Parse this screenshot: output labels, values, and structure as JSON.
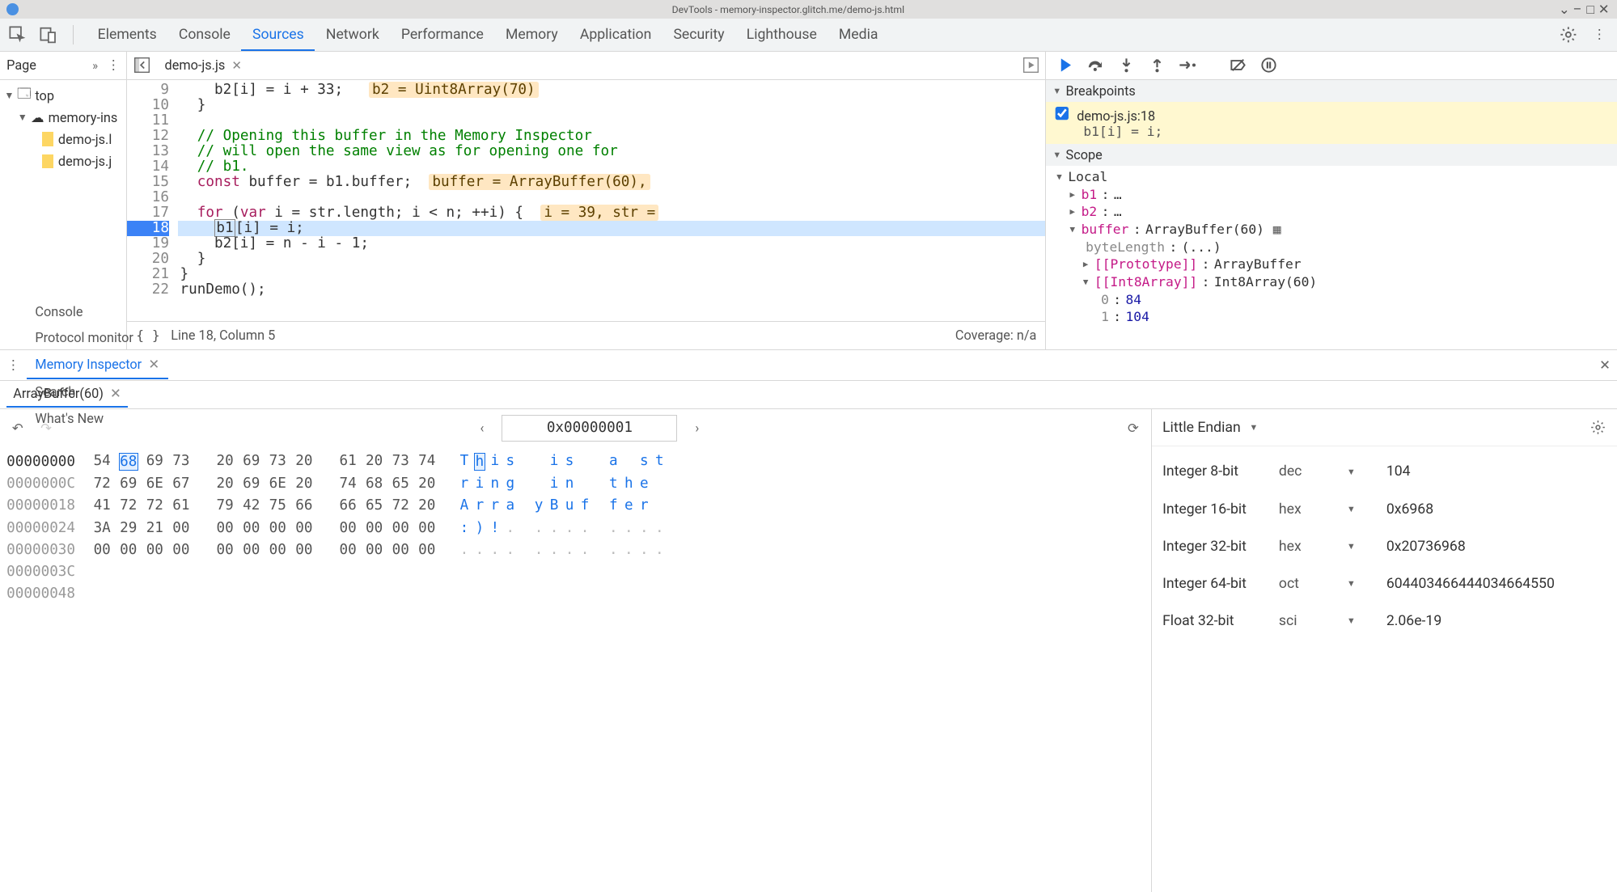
{
  "window_title": "DevTools - memory-inspector.glitch.me/demo-js.html",
  "top_tabs": [
    "Elements",
    "Console",
    "Sources",
    "Network",
    "Performance",
    "Memory",
    "Application",
    "Security",
    "Lighthouse",
    "Media"
  ],
  "top_active": 2,
  "left": {
    "page_label": "Page",
    "tree": {
      "root": "top",
      "domain": "memory-ins",
      "files": [
        "demo-js.l",
        "demo-js.j"
      ]
    }
  },
  "editor": {
    "filename": "demo-js.js",
    "lines": [
      {
        "n": 9,
        "html": "    b2[i] = i + 33;   <span class='val-pill'>b2 = Uint8Array(70)</span>"
      },
      {
        "n": 10,
        "html": "  }"
      },
      {
        "n": 11,
        "html": ""
      },
      {
        "n": 12,
        "html": "  <span class='cm'>// Opening this buffer in the Memory Inspector</span>"
      },
      {
        "n": 13,
        "html": "  <span class='cm'>// will open the same view as for opening one for</span>"
      },
      {
        "n": 14,
        "html": "  <span class='cm'>// b1.</span>"
      },
      {
        "n": 15,
        "html": "  <span class='kw'>const</span> buffer = b1.buffer;  <span class='val-pill'>buffer = ArrayBuffer(60),</span>"
      },
      {
        "n": 16,
        "html": ""
      },
      {
        "n": 17,
        "html": "  <span class='kw'>for</span> (<span class='kw'>var</span> i = str.length; i &lt; n; ++i) {  <span class='val-pill'>i = 39, str =</span>"
      },
      {
        "n": 18,
        "html": "    <span class='cur-box'>b1</span>[i] = i;",
        "hl": true
      },
      {
        "n": 19,
        "html": "    b2[i] = n - i - 1;"
      },
      {
        "n": 20,
        "html": "  }"
      },
      {
        "n": 21,
        "html": "}"
      },
      {
        "n": 22,
        "html": "runDemo();"
      }
    ],
    "status_line": "Line 18, Column 5",
    "status_coverage": "Coverage: n/a"
  },
  "dbg": {
    "breakpoints_label": "Breakpoints",
    "bp_loc": "demo-js.js:18",
    "bp_expr": "b1[i] = i;",
    "scope_label": "Scope",
    "local_label": "Local",
    "vars": [
      {
        "k": "b1",
        "v": "…"
      },
      {
        "k": "b2",
        "v": "…"
      }
    ],
    "buffer_k": "buffer",
    "buffer_v": "ArrayBuffer(60)",
    "bytelen_k": "byteLength",
    "bytelen_v": "(...)",
    "proto_k": "[[Prototype]]",
    "proto_v": "ArrayBuffer",
    "int8_k": "[[Int8Array]]",
    "int8_v": "Int8Array(60)",
    "arr": [
      {
        "i": "0",
        "v": "84"
      },
      {
        "i": "1",
        "v": "104"
      }
    ]
  },
  "drawer": {
    "tabs": [
      "Console",
      "Protocol monitor",
      "Memory Inspector",
      "Search",
      "What's New"
    ],
    "active": 2,
    "subtab": "ArrayBuffer(60)",
    "address": "0x00000001",
    "hex": {
      "offsets": [
        "00000000",
        "0000000C",
        "00000018",
        "00000024",
        "00000030",
        "0000003C",
        "00000048"
      ],
      "rows": [
        {
          "bytes": [
            "54",
            "68",
            "69",
            "73",
            "20",
            "69",
            "73",
            "20",
            "61",
            "20",
            "73",
            "74"
          ],
          "ascii": [
            "T",
            "h",
            "i",
            "s",
            " ",
            "i",
            "s",
            " ",
            "a",
            " ",
            "s",
            "t"
          ]
        },
        {
          "bytes": [
            "72",
            "69",
            "6E",
            "67",
            "20",
            "69",
            "6E",
            "20",
            "74",
            "68",
            "65",
            "20"
          ],
          "ascii": [
            "r",
            "i",
            "n",
            "g",
            " ",
            "i",
            "n",
            " ",
            "t",
            "h",
            "e",
            " "
          ]
        },
        {
          "bytes": [
            "41",
            "72",
            "72",
            "61",
            "79",
            "42",
            "75",
            "66",
            "66",
            "65",
            "72",
            "20"
          ],
          "ascii": [
            "A",
            "r",
            "r",
            "a",
            "y",
            "B",
            "u",
            "f",
            "f",
            "e",
            "r",
            " "
          ]
        },
        {
          "bytes": [
            "3A",
            "29",
            "21",
            "00",
            "00",
            "00",
            "00",
            "00",
            "00",
            "00",
            "00",
            "00"
          ],
          "ascii": [
            ":",
            ")",
            "!",
            ".",
            ".",
            ".",
            ".",
            ".",
            ".",
            ".",
            ".",
            "."
          ]
        },
        {
          "bytes": [
            "00",
            "00",
            "00",
            "00",
            "00",
            "00",
            "00",
            "00",
            "00",
            "00",
            "00",
            "00"
          ],
          "ascii": [
            ".",
            ".",
            ".",
            ".",
            ".",
            ".",
            ".",
            ".",
            ".",
            ".",
            ".",
            "."
          ]
        }
      ],
      "selected_row": 0,
      "selected_col": 1
    },
    "endian": "Little Endian",
    "values": [
      {
        "label": "Integer 8-bit",
        "fmt": "dec",
        "val": "104"
      },
      {
        "label": "Integer 16-bit",
        "fmt": "hex",
        "val": "0x6968"
      },
      {
        "label": "Integer 32-bit",
        "fmt": "hex",
        "val": "0x20736968"
      },
      {
        "label": "Integer 64-bit",
        "fmt": "oct",
        "val": "604403466444034664550"
      },
      {
        "label": "Float 32-bit",
        "fmt": "sci",
        "val": "2.06e-19"
      }
    ]
  }
}
